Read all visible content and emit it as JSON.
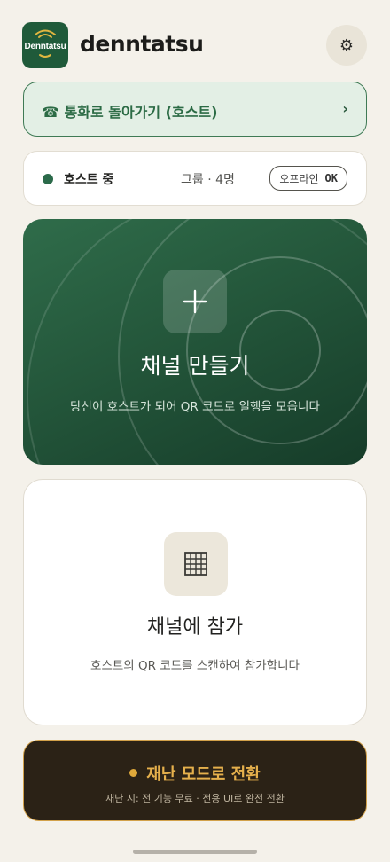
{
  "header": {
    "logo_text": "Denntatsu",
    "app_name": "denntatsu",
    "settings_icon": "gear-icon"
  },
  "return_call": {
    "icon": "phone-icon",
    "label": "☎ 통화로 돌아가기 (호스트)",
    "chevron": "›"
  },
  "status": {
    "state": "호스트 중",
    "group": "그룹 · 4명",
    "offline_label": "오프라인",
    "offline_value": "OK",
    "dot_color": "#2b6a4a"
  },
  "create_channel": {
    "icon": "plus-icon",
    "title": "채널 만들기",
    "subtitle": "당신이 호스트가 되어 QR 코드로 일행을 모읍니다"
  },
  "join_channel": {
    "icon": "qr-grid-icon",
    "title": "채널에 참가",
    "subtitle": "호스트의 QR 코드를 스캔하여 참가합니다"
  },
  "disaster_mode": {
    "title": "재난 모드로 전환",
    "subtitle": "재난 시: 전 기능 무료 · 전용 UI로 완전 전환",
    "accent": "#e5b04c"
  }
}
